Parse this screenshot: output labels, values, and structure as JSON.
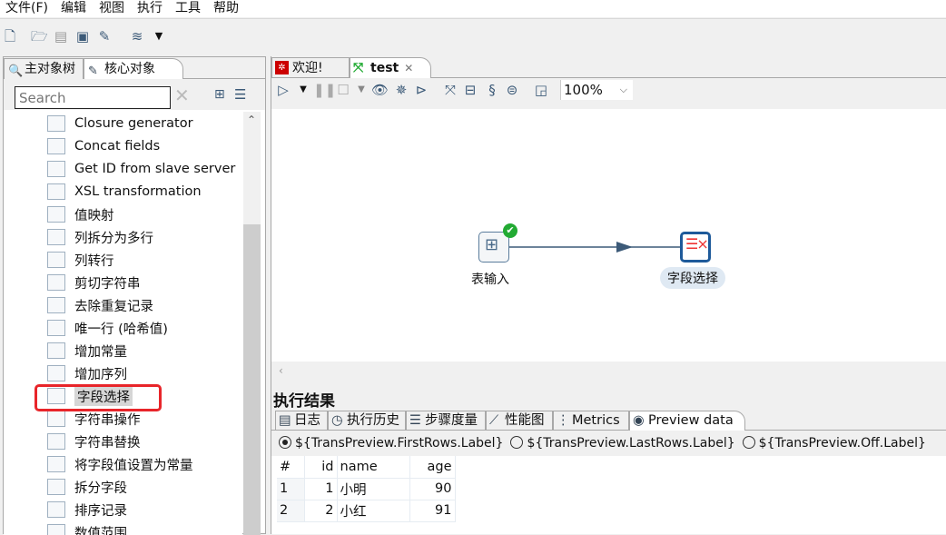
{
  "menu": [
    "文件(F)",
    "编辑",
    "视图",
    "执行",
    "工具",
    "帮助"
  ],
  "left_panel": {
    "tabs": [
      {
        "label": "主对象树",
        "icon": "search-file-icon"
      },
      {
        "label": "核心对象",
        "icon": "pencil-icon"
      }
    ],
    "search_placeholder": "Search",
    "items": [
      {
        "label": "Closure generator",
        "icon": "closure-icon"
      },
      {
        "label": "Concat fields",
        "icon": "grid-icon"
      },
      {
        "label": "Get ID from slave server",
        "icon": "id-icon"
      },
      {
        "label": "XSL transformation",
        "icon": "xsl-icon"
      },
      {
        "label": "值映射",
        "icon": "value-map-icon"
      },
      {
        "label": "列拆分为多行",
        "icon": "split-rows-icon"
      },
      {
        "label": "列转行",
        "icon": "pivot-icon"
      },
      {
        "label": "剪切字符串",
        "icon": "scissors-icon"
      },
      {
        "label": "去除重复记录",
        "icon": "unique-icon"
      },
      {
        "label": "唯一行 (哈希值)",
        "icon": "hash-icon"
      },
      {
        "label": "增加常量",
        "icon": "constant-icon"
      },
      {
        "label": "增加序列",
        "icon": "sequence-icon"
      },
      {
        "label": "字段选择",
        "icon": "select-fields-icon",
        "selected": true
      },
      {
        "label": "字符串操作",
        "icon": "string-ops-icon"
      },
      {
        "label": "字符串替换",
        "icon": "replace-icon"
      },
      {
        "label": "将字段值设置为常量",
        "icon": "set-constant-icon"
      },
      {
        "label": "拆分字段",
        "icon": "split-field-icon"
      },
      {
        "label": "排序记录",
        "icon": "sort-icon"
      },
      {
        "label": "数值范围",
        "icon": "number-range-icon"
      }
    ]
  },
  "editor": {
    "tabs": [
      {
        "label": "欢迎!",
        "icon": "welcome-icon"
      },
      {
        "label": "test",
        "icon": "transform-icon",
        "active": true
      }
    ],
    "zoom": "100%",
    "steps": [
      {
        "label": "表输入",
        "icon": "table-input-icon",
        "status": "success"
      },
      {
        "label": "字段选择",
        "icon": "select-fields-icon"
      }
    ]
  },
  "results": {
    "title": "执行结果",
    "tabs": [
      "日志",
      "执行历史",
      "步骤度量",
      "性能图",
      "Metrics",
      "Preview data"
    ],
    "radios": [
      {
        "label": "${TransPreview.FirstRows.Label}",
        "checked": true
      },
      {
        "label": "${TransPreview.LastRows.Label}",
        "checked": false
      },
      {
        "label": "${TransPreview.Off.Label}",
        "checked": false
      }
    ],
    "columns": [
      "#",
      "id",
      "name",
      "age"
    ],
    "rows": [
      [
        "1",
        "1",
        "小明",
        "90"
      ],
      [
        "2",
        "2",
        "小红",
        "91"
      ]
    ]
  },
  "colors": {
    "accent": "#3c5a78",
    "highlight": "#e8252a",
    "success": "#22aa33"
  }
}
